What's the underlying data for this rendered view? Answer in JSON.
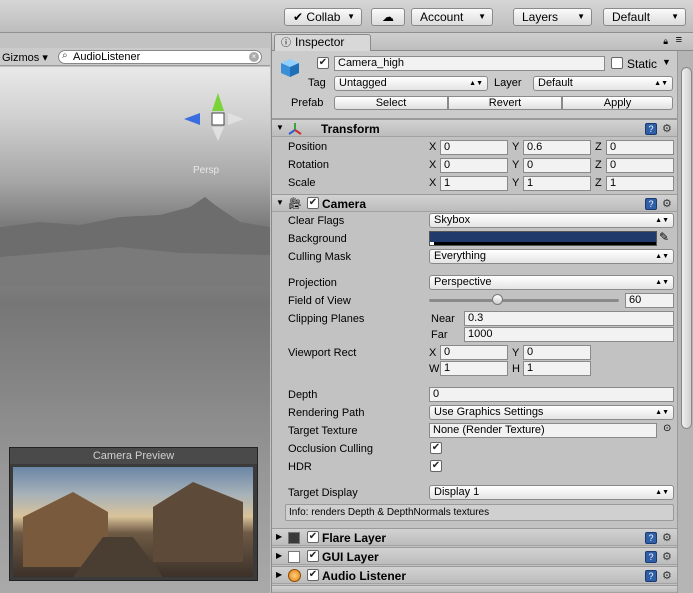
{
  "toolbar": {
    "collab": "Collab",
    "cloud_icon": "cloud-icon",
    "account": "Account",
    "layers": "Layers",
    "layout": "Default"
  },
  "scene": {
    "gizmos": "Gizmos",
    "search_value": "AudioListener",
    "persp": "Persp",
    "camera_preview_title": "Camera Preview"
  },
  "inspector": {
    "tab": "Inspector",
    "object": {
      "name": "Camera_high",
      "static_label": "Static",
      "tag_label": "Tag",
      "tag_value": "Untagged",
      "layer_label": "Layer",
      "layer_value": "Default",
      "prefab_label": "Prefab",
      "prefab_buttons": [
        "Select",
        "Revert",
        "Apply"
      ]
    },
    "transform": {
      "title": "Transform",
      "rows": [
        {
          "label": "Position",
          "x": "0",
          "y": "0.6",
          "z": "0"
        },
        {
          "label": "Rotation",
          "x": "0",
          "y": "0",
          "z": "0"
        },
        {
          "label": "Scale",
          "x": "1",
          "y": "1",
          "z": "1"
        }
      ]
    },
    "camera": {
      "title": "Camera",
      "clear_flags_label": "Clear Flags",
      "clear_flags": "Skybox",
      "background_label": "Background",
      "background_color": "#1f3a6b",
      "culling_mask_label": "Culling Mask",
      "culling_mask": "Everything",
      "projection_label": "Projection",
      "projection": "Perspective",
      "fov_label": "Field of View",
      "fov": "60",
      "fov_fraction": 0.36,
      "clipping_label": "Clipping Planes",
      "near_label": "Near",
      "near": "0.3",
      "far_label": "Far",
      "far": "1000",
      "viewport_label": "Viewport Rect",
      "vp_x": "0",
      "vp_y": "0",
      "vp_w": "1",
      "vp_h": "1",
      "depth_label": "Depth",
      "depth": "0",
      "rendering_path_label": "Rendering Path",
      "rendering_path": "Use Graphics Settings",
      "target_texture_label": "Target Texture",
      "target_texture": "None (Render Texture)",
      "occlusion_label": "Occlusion Culling",
      "hdr_label": "HDR",
      "target_display_label": "Target Display",
      "target_display": "Display 1",
      "info": "Info: renders Depth & DepthNormals textures"
    },
    "components": [
      {
        "title": "Flare Layer"
      },
      {
        "title": "GUI Layer"
      },
      {
        "title": "Audio Listener"
      }
    ]
  }
}
